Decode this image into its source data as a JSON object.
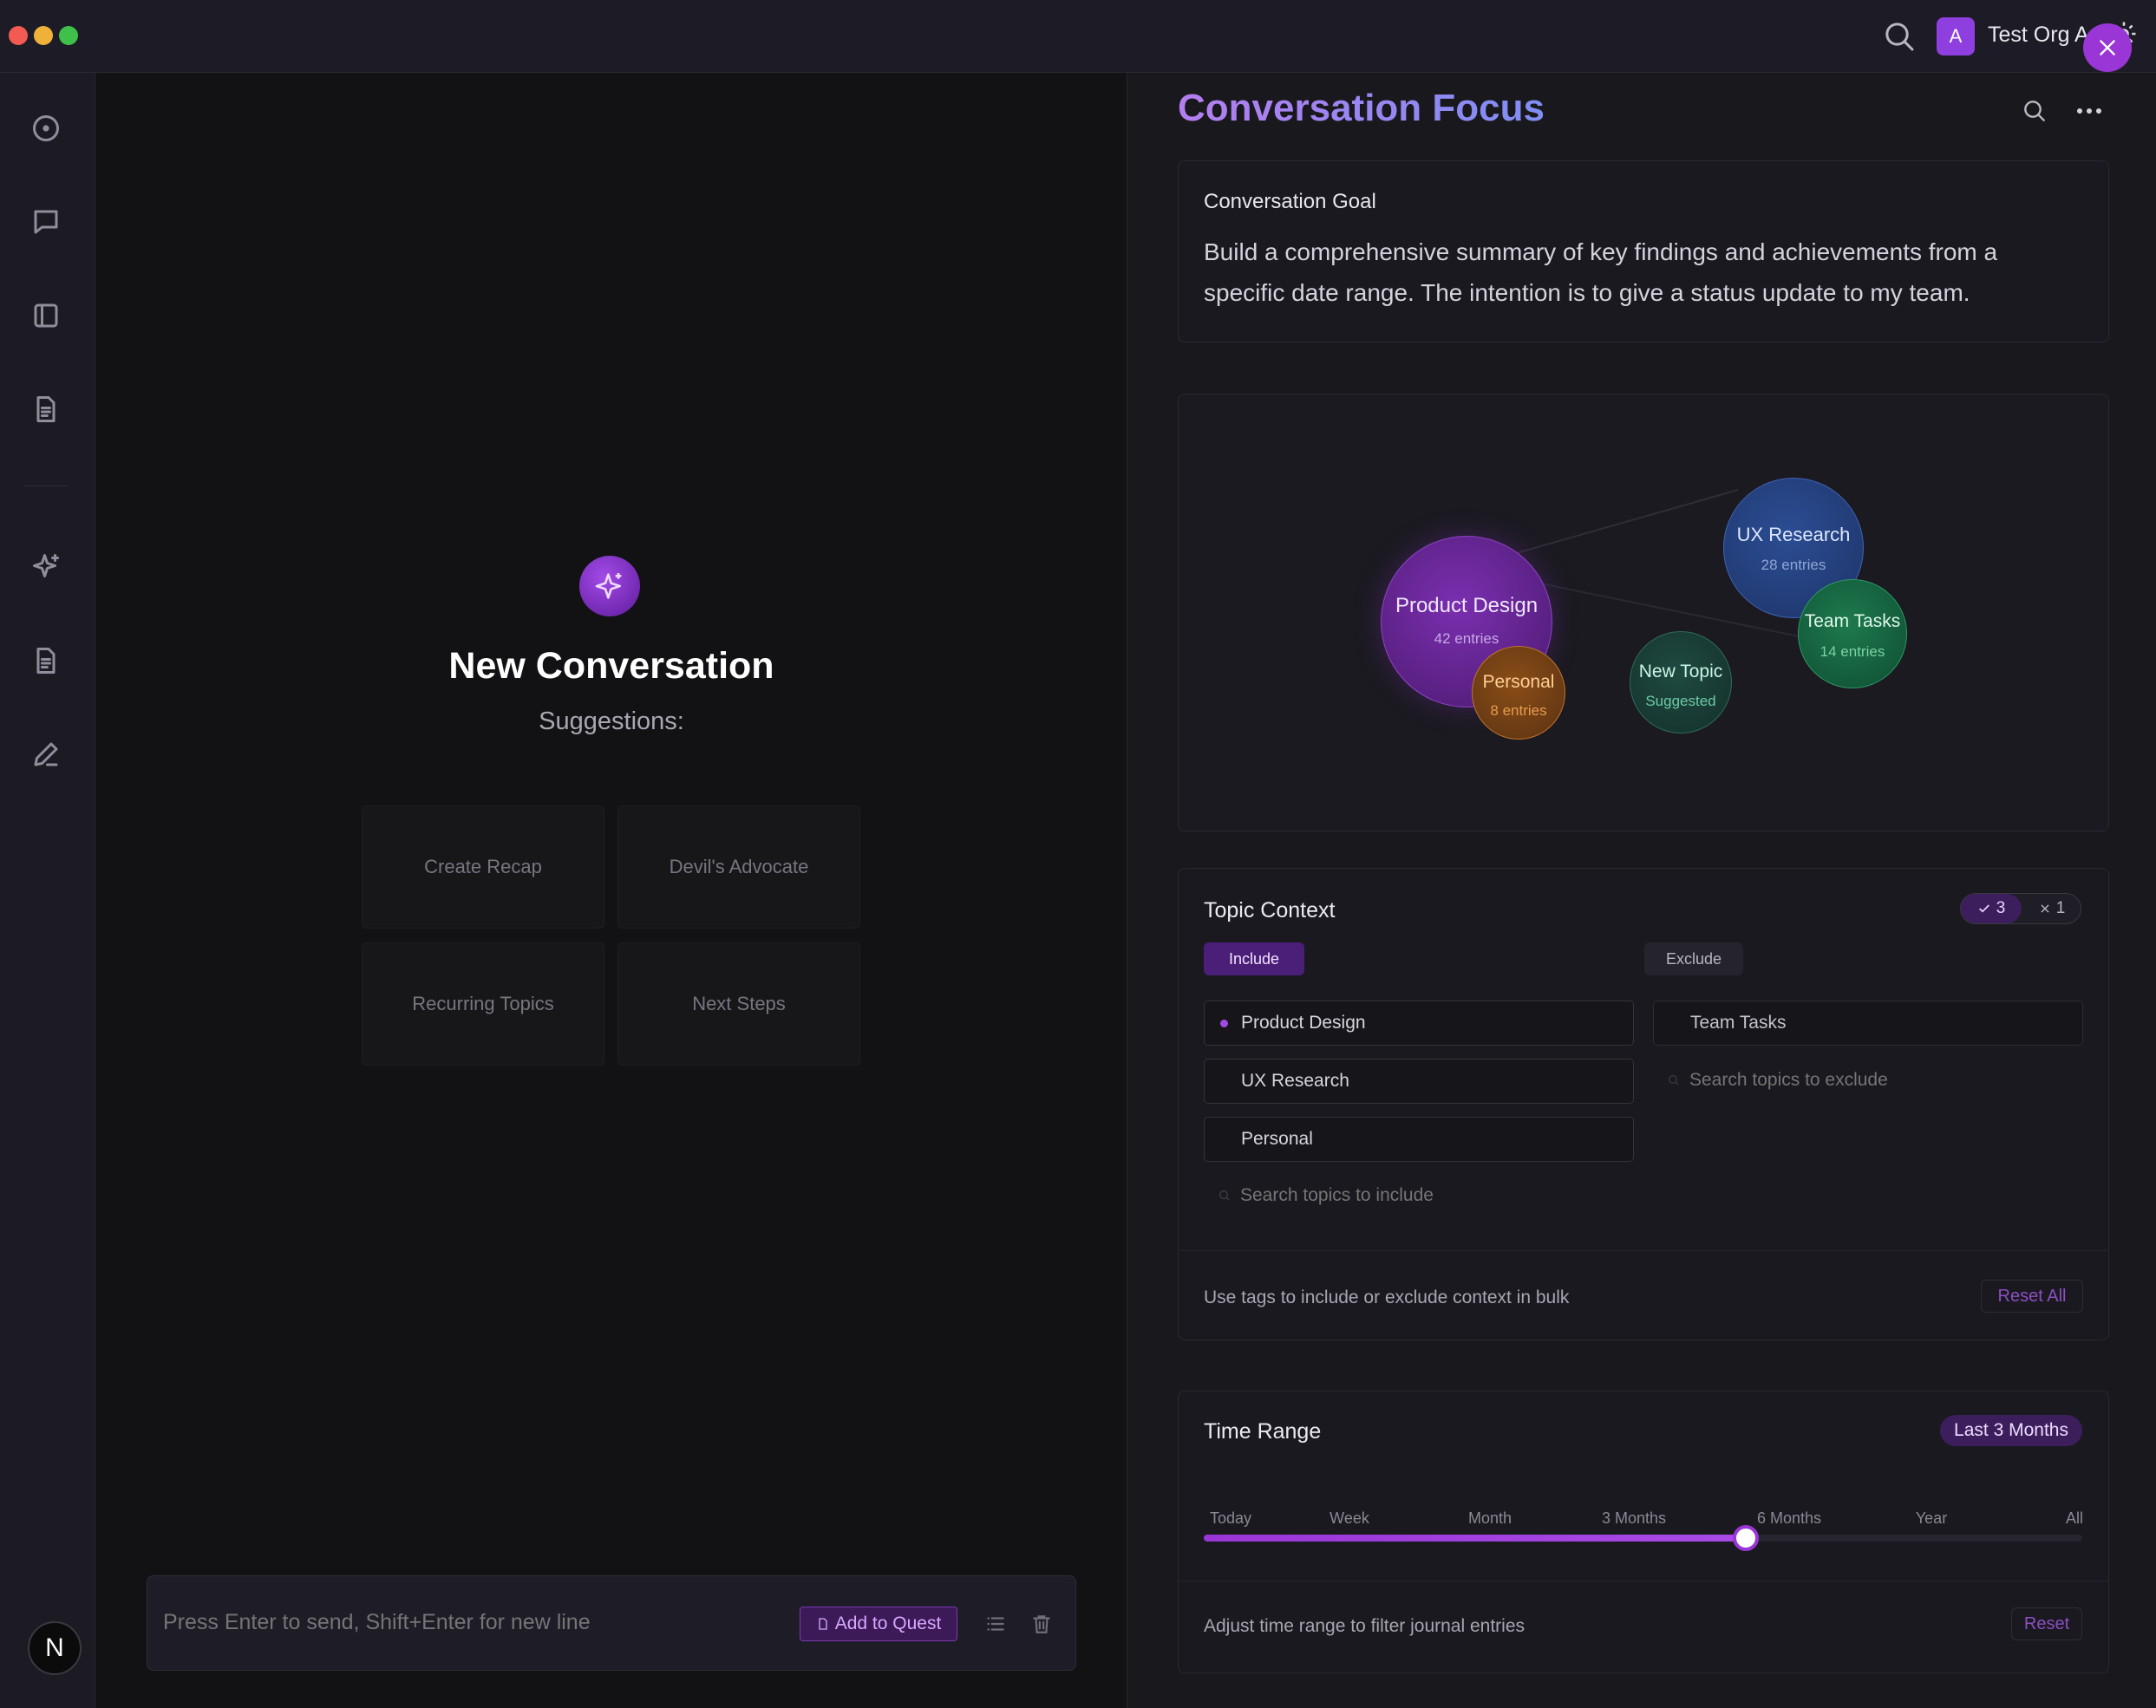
{
  "titlebar": {
    "avatar_letter": "A",
    "org_name": "Test Org A",
    "icons": [
      "search-icon",
      "settings-icon",
      "close-icon"
    ]
  },
  "sidebar": {
    "items": [
      "compass-icon",
      "chat-icon",
      "sidebar-panel-icon",
      "document-icon",
      "sparkle-icon",
      "notes-icon",
      "pen-icon"
    ],
    "user_initial": "N"
  },
  "main": {
    "title": "New Conversation",
    "subtitle": "Suggestions:",
    "suggestions": [
      "Create Recap",
      "Devil's Advocate",
      "Recurring Topics",
      "Next Steps"
    ],
    "composer": {
      "placeholder": "Press Enter to send, Shift+Enter for new line",
      "add_to_quest": "Add to Quest"
    }
  },
  "panel": {
    "title": "Conversation Focus",
    "goal": {
      "heading": "Conversation Goal",
      "text_line1": "Build a comprehensive summary of key findings and achievements from a",
      "text_line2": "specific date range. The intention is to give a status update to my team."
    },
    "bubbles": [
      {
        "label": "Product Design",
        "sub": "42 entries",
        "color": "#7b2fb0"
      },
      {
        "label": "UX Research",
        "sub": "28 entries",
        "color": "#2c4d94"
      },
      {
        "label": "Team Tasks",
        "sub": "14 entries",
        "color": "#1d7a4e"
      },
      {
        "label": "Personal",
        "sub": "8 entries",
        "color": "#b86a1d"
      },
      {
        "label": "New Topic",
        "sub": "Suggested",
        "color": "#1f5a4a"
      }
    ],
    "topic_context": {
      "heading": "Topic Context",
      "include_count": "3",
      "exclude_count": "1",
      "include_label": "Include",
      "exclude_label": "Exclude",
      "included": [
        "Product Design",
        "UX Research",
        "Personal"
      ],
      "excluded": [
        "Team Tasks"
      ],
      "include_search_placeholder": "Search topics to include",
      "exclude_search_placeholder": "Search topics to exclude",
      "footer": "Use tags to include or exclude context in bulk",
      "reset_all": "Reset All"
    },
    "time_range": {
      "heading": "Time Range",
      "selected_badge": "Last 3 Months",
      "ticks": [
        "Today",
        "Week",
        "Month",
        "3 Months",
        "6 Months",
        "Year",
        "All"
      ],
      "slider_value_fraction": 0.617,
      "footer": "Adjust time range to filter journal entries",
      "reset": "Reset"
    }
  },
  "colors": {
    "accent": "#8a3fd1",
    "title_gradient_start": "#b57ef0",
    "title_gradient_end": "#7f8ef2"
  }
}
